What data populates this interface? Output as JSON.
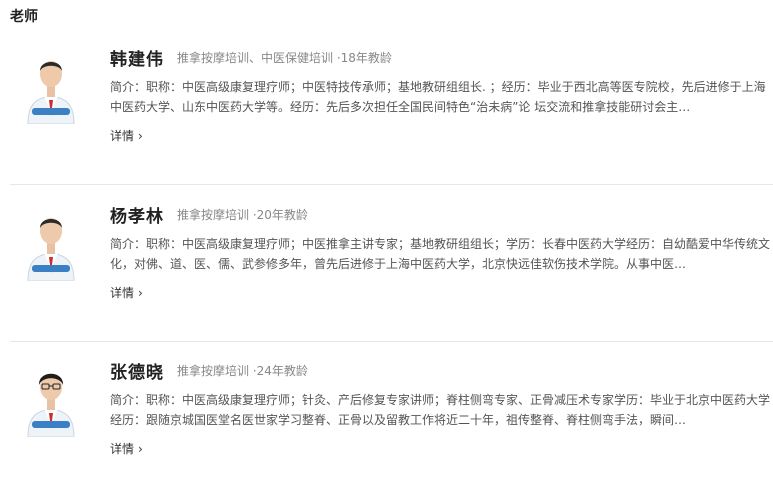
{
  "section_title": "老师",
  "detail_label": "详情",
  "teachers": [
    {
      "name": "韩建伟",
      "tags": "推拿按摩培训、中医保健培训 ·18年教龄",
      "bio": "简介：职称：中医高级康复理疗师；中医特技传承师；基地教研组组长. ；经历：毕业于西北高等医专院校，先后进修于上海中医药大学、山东中医药大学等。经历：先后多次担任全国民间特色“治未病”论 坛交流和推拿技能研讨会主…"
    },
    {
      "name": "杨孝林",
      "tags": "推拿按摩培训 ·20年教龄",
      "bio": "简介：职称：中医高级康复理疗师；中医推拿主讲专家；基地教研组组长；学历：长春中医药大学经历：自幼酷爱中华传统文化，对佛、道、医、儒、武参修多年，曾先后进修于上海中医药大学，北京快远佳软伤技术学院。从事中医…"
    },
    {
      "name": "张德晓",
      "tags": "推拿按摩培训 ·24年教龄",
      "bio": "简介：职称：中医高级康复理疗师；针灸、产后修复专家讲师；脊柱侧弯专家、正骨减压术专家学历：毕业于北京中医药大学经历：跟随京城国医堂名医世家学习整脊、正骨以及留教工作将近二十年，祖传整脊、脊柱侧弯手法，瞬间…"
    }
  ]
}
